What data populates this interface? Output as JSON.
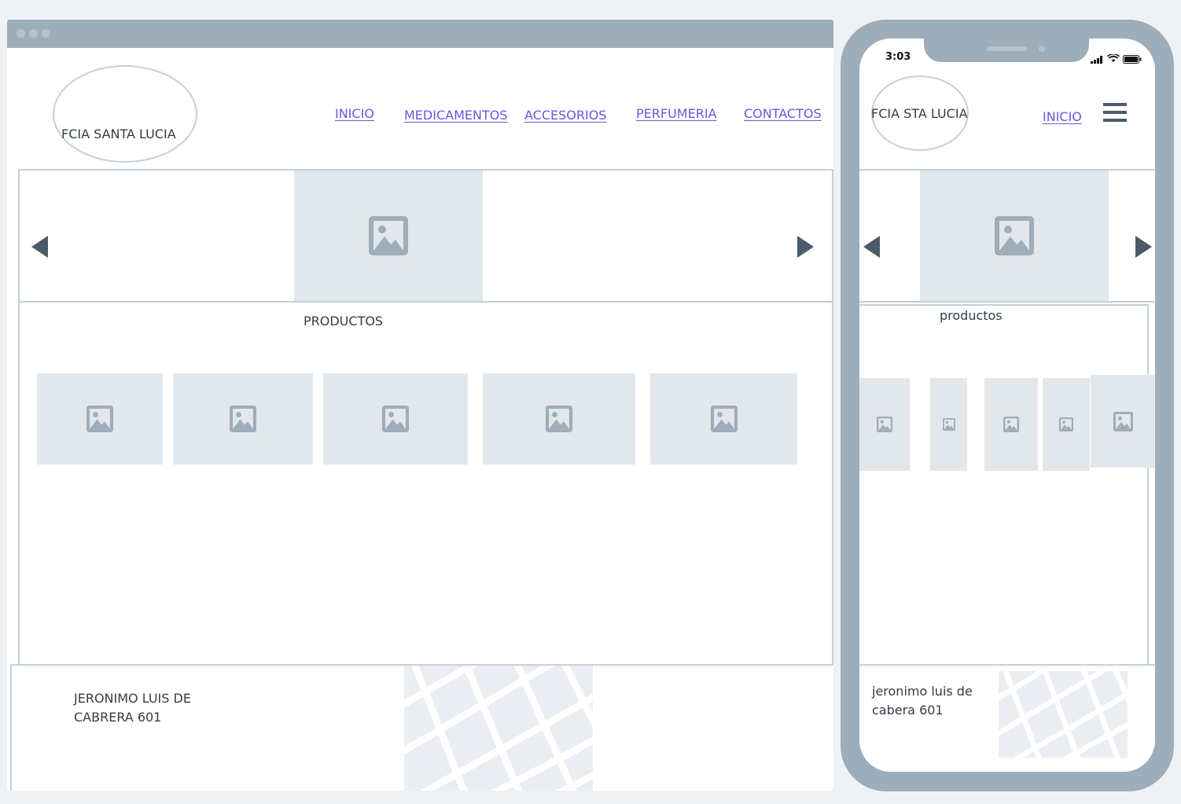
{
  "desktop": {
    "logo": {
      "text": "FCIA SANTA LUCIA"
    },
    "nav": [
      {
        "label": "INICIO"
      },
      {
        "label": "MEDICAMENTOS"
      },
      {
        "label": "ACCESORIOS"
      },
      {
        "label": "PERFUMERIA"
      },
      {
        "label": "CONTACTOS"
      }
    ],
    "products": {
      "title": "PRODUCTOS"
    },
    "footer": {
      "address_line1": "JERONIMO LUIS DE",
      "address_line2": "CABRERA 601"
    }
  },
  "mobile": {
    "status": {
      "time": "3:03"
    },
    "logo": {
      "text": "FCIA  STA LUCIA"
    },
    "nav": {
      "label": "INICIO"
    },
    "products": {
      "title": "productos"
    },
    "footer": {
      "address_line1": "jeronimo luis de",
      "address_line2": "cabera 601"
    }
  },
  "icons": {
    "image_placeholder": "image-icon",
    "slider_prev": "triangle-left",
    "slider_next": "triangle-right",
    "menu": "hamburger-icon"
  },
  "colors": {
    "frame": "#9eadba",
    "placeholder": "#e2e7eb",
    "link": "#6b55e0",
    "text": "#323c47",
    "border": "#c5d0d9"
  }
}
